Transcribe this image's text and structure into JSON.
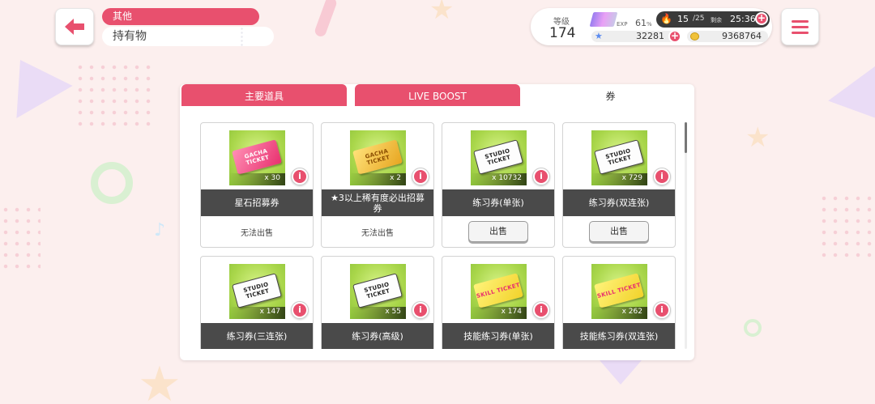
{
  "header": {
    "category": "其他",
    "title": "持有物"
  },
  "status": {
    "level_label": "等级",
    "level": "174",
    "exp_label": "EXP",
    "exp_value": "61",
    "exp_unit": "%",
    "stamina": "15",
    "stamina_max": "/25",
    "remain_label": "剩余",
    "remain_time": "25:36",
    "gems": "32281",
    "coins": "9368764"
  },
  "tabs": [
    {
      "label": "主要道具",
      "active": false
    },
    {
      "label": "LIVE BOOST",
      "active": false
    },
    {
      "label": "券",
      "active": true
    }
  ],
  "items": [
    {
      "name": "星石招募券",
      "qty": "x 30",
      "ticket_text": "GACHA TICKET",
      "ticket_color": "pink",
      "status": "无法出售",
      "sellable": false
    },
    {
      "name": "★3以上稀有度必出招募券",
      "qty": "x 2",
      "ticket_text": "GACHA TICKET",
      "ticket_color": "gold",
      "status": "无法出售",
      "sellable": false
    },
    {
      "name": "练习券(单张)",
      "qty": "x 10732",
      "ticket_text": "STUDIO TICKET",
      "ticket_color": "white",
      "status": "出售",
      "sellable": true
    },
    {
      "name": "练习券(双连张)",
      "qty": "x 729",
      "ticket_text": "STUDIO TICKET",
      "ticket_color": "white",
      "status": "出售",
      "sellable": true
    },
    {
      "name": "练习券(三连张)",
      "qty": "x 147",
      "ticket_text": "STUDIO TICKET",
      "ticket_color": "white",
      "status": "",
      "sellable": false
    },
    {
      "name": "练习券(高级)",
      "qty": "x 55",
      "ticket_text": "STUDIO TICKET",
      "ticket_color": "white",
      "status": "",
      "sellable": false
    },
    {
      "name": "技能练习券(单张)",
      "qty": "x 174",
      "ticket_text": "SKILL TICKET",
      "ticket_color": "yellow",
      "status": "",
      "sellable": false
    },
    {
      "name": "技能练习券(双连张)",
      "qty": "x 262",
      "ticket_text": "SKILL TICKET",
      "ticket_color": "yellow",
      "status": "",
      "sellable": false
    }
  ],
  "colors": {
    "accent": "#e8506e",
    "background": "#fcefee",
    "name_bar": "#4a4a4a"
  }
}
